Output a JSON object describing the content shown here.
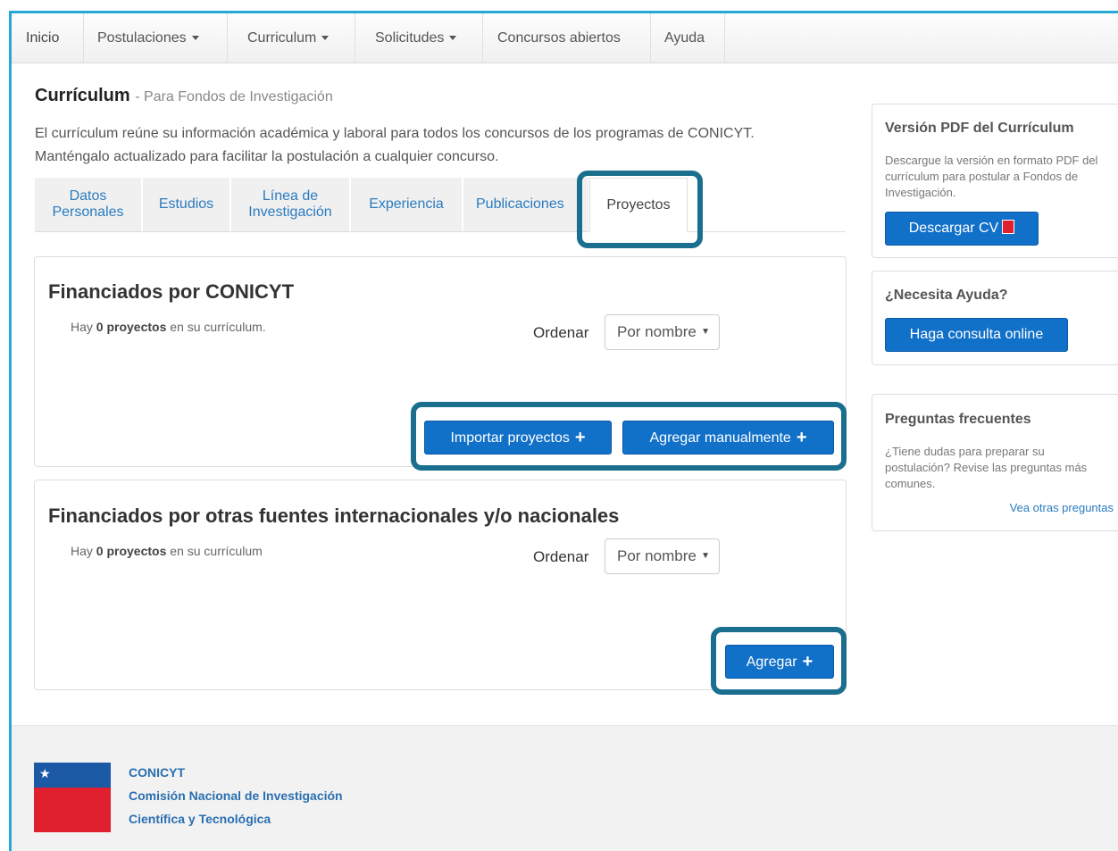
{
  "nav": {
    "items": [
      {
        "label": "Inicio"
      },
      {
        "label": "Postulaciones"
      },
      {
        "label": "Curriculum"
      },
      {
        "label": "Solicitudes"
      },
      {
        "label": "Concursos abiertos"
      },
      {
        "label": "Ayuda"
      }
    ]
  },
  "page": {
    "title": "Currículum",
    "subtitle": "- Para Fondos de Investigación",
    "intro": "El currículum reúne su información académica y laboral para todos los concursos de los programas de CONICYT. Manténgalo actualizado para facilitar la postulación a cualquier concurso."
  },
  "tabs": [
    {
      "label": "Datos Personales"
    },
    {
      "label": "Estudios"
    },
    {
      "label": "Línea de Investigación"
    },
    {
      "label": "Experiencia"
    },
    {
      "label": "Publicaciones"
    },
    {
      "label": "Proyectos",
      "active": true
    }
  ],
  "panel1": {
    "title": "Financiados por CONICYT",
    "count_prefix": "Hay ",
    "count_bold": "0 proyectos",
    "count_suffix": " en su currículum.",
    "order_label": "Ordenar",
    "order_value": "Por nombre",
    "import_label": "Importar proyectos",
    "manual_label": "Agregar manualmente"
  },
  "panel2": {
    "title": "Financiados por otras fuentes internacionales y/o nacionales",
    "count_prefix": "Hay ",
    "count_bold": "0 proyectos",
    "count_suffix": " en su currículum",
    "order_label": "Ordenar",
    "order_value": "Por nombre",
    "add_label": "Agregar"
  },
  "sidebar": {
    "pdf": {
      "title": "Versión PDF del Currículum",
      "text": "Descargue la versión en formato PDF del currículum para postular a Fondos de Investigación.",
      "button": "Descargar CV"
    },
    "help": {
      "title": "¿Necesita Ayuda?",
      "button": "Haga consulta online"
    },
    "faq": {
      "title": "Preguntas frecuentes",
      "text": "¿Tiene dudas para preparar su postulación? Revise las preguntas más comunes.",
      "link": "Vea otras preguntas"
    }
  },
  "footer": {
    "line1": "CONICYT",
    "line2": "Comisión Nacional de Investigación",
    "line3": "Científica y Tecnológica"
  },
  "colors": {
    "accent": "#1170c8",
    "highlight": "#1a6f8f",
    "frame": "#27a9d8"
  }
}
